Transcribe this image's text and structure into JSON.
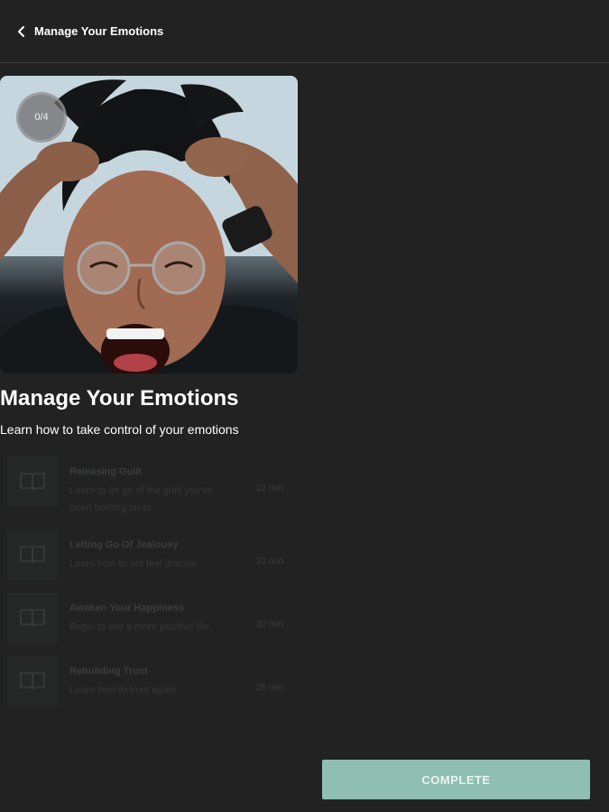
{
  "header": {
    "title": "Manage Your Emotions",
    "back_icon": "chevron-left-icon"
  },
  "course": {
    "progress": "0/4",
    "title": "Manage Your Emotions",
    "subtitle": "Learn how to take control of your emotions"
  },
  "lessons": [
    {
      "title": "Releasing Guilt",
      "desc": "Learn to let go of the guilt you've been holding on to",
      "duration": "22 min",
      "icon": "book-icon"
    },
    {
      "title": "Letting Go Of Jealousy",
      "desc": "Learn how to not feel jealous",
      "duration": "32 min",
      "icon": "book-icon"
    },
    {
      "title": "Awaken Your Happiness",
      "desc": "Begin to live a more positive life",
      "duration": "30 min",
      "icon": "book-icon"
    },
    {
      "title": "Rebuilding Trust",
      "desc": "Learn how to trust again",
      "duration": "25 min",
      "icon": "book-icon"
    }
  ],
  "actions": {
    "complete_label": "COMPLETE"
  },
  "colors": {
    "background": "#222222",
    "accent": "#8fbfb0"
  }
}
